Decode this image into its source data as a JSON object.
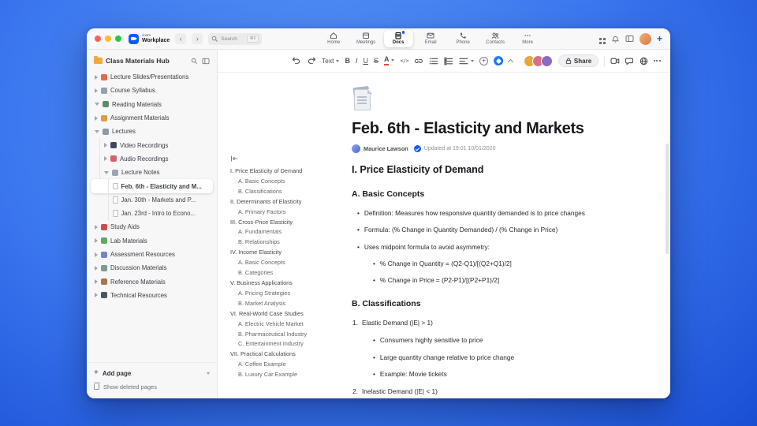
{
  "accent_color": "#0b5cff",
  "titlebar": {
    "traffic_lights": [
      "#ff5f57",
      "#febc2e",
      "#28c840"
    ],
    "logo_zoom": "zoom",
    "logo_workplace": "Workplace",
    "nav_back": "‹",
    "nav_forward": "›",
    "search_placeholder": "Search",
    "search_shortcut": "⌘F",
    "tabs": [
      {
        "label": "Home"
      },
      {
        "label": "Meetings"
      },
      {
        "label": "Docs",
        "active": true
      },
      {
        "label": "Email"
      },
      {
        "label": "Phone"
      },
      {
        "label": "Contacts"
      },
      {
        "label": "More"
      }
    ],
    "plus_label": "+"
  },
  "sidebar": {
    "title": "Class Materials Hub",
    "items": [
      {
        "label": "Lecture Slides/Presentations",
        "level": 0,
        "chevron": "right",
        "color": "#e06b4e"
      },
      {
        "label": "Course Syllabus",
        "level": 0,
        "chevron": "right",
        "color": "#93a1b1"
      },
      {
        "label": "Reading Materials",
        "level": 0,
        "chevron": "down",
        "color": "#5f8a6e"
      },
      {
        "label": "Assignment Materials",
        "level": 0,
        "chevron": "right",
        "color": "#e09a3e"
      },
      {
        "label": "Lectures",
        "level": 0,
        "chevron": "down",
        "color": "#8e98a8"
      },
      {
        "label": "Video Recordings",
        "level": 1,
        "chevron": "right",
        "color": "#3f4a5a"
      },
      {
        "label": "Audio Recordings",
        "level": 1,
        "chevron": "right",
        "color": "#d4606e"
      },
      {
        "label": "Lecture Notes",
        "level": 1,
        "chevron": "down",
        "color": "#9aa6b4"
      },
      {
        "label": "Feb. 6th - Elasticity and M...",
        "level": 2,
        "file": true,
        "selected": true
      },
      {
        "label": "Jan. 30th - Markets and P...",
        "level": 2,
        "file": true
      },
      {
        "label": "Jan. 23rd - Intro to Econo...",
        "level": 2,
        "file": true
      },
      {
        "label": "Study Aids",
        "level": 0,
        "chevron": "right",
        "color": "#c9504e"
      },
      {
        "label": "Lab Materials",
        "level": 0,
        "chevron": "right",
        "color": "#62a85e"
      },
      {
        "label": "Assessment Resources",
        "level": 0,
        "chevron": "right",
        "color": "#7287c2"
      },
      {
        "label": "Discussion Materials",
        "level": 0,
        "chevron": "right",
        "color": "#7f9b8e"
      },
      {
        "label": "Reference Materials",
        "level": 0,
        "chevron": "right",
        "color": "#a8764a"
      },
      {
        "label": "Technical Resources",
        "level": 0,
        "chevron": "right",
        "color": "#4a5568"
      }
    ],
    "add_page": "Add page",
    "add_page_plus": "+",
    "show_deleted": "Show deleted pages"
  },
  "toolbar": {
    "text_style": "Text",
    "bold": "B",
    "italic": "I",
    "underline": "U",
    "strikethrough": "S",
    "font_color": "A",
    "code": "</>",
    "plus": "+",
    "share": "Share",
    "avatars": [
      {
        "color": "#e5a83c"
      },
      {
        "color": "#d97087"
      },
      {
        "color": "#8a6bbf"
      }
    ]
  },
  "doc": {
    "title": "Feb. 6th - Elasticity and Markets",
    "author": "Maurice Lawson",
    "updated": "Updated at 19:01 10/01/2020"
  },
  "outline": {
    "items": [
      {
        "label": "I. Price Elasticity of Demand",
        "level": 0
      },
      {
        "label": "A. Basic Concepts",
        "level": 1
      },
      {
        "label": "B. Classifications",
        "level": 1
      },
      {
        "label": "II. Determinants of Elasticity",
        "level": 0
      },
      {
        "label": "A. Primary Factors",
        "level": 1
      },
      {
        "label": "III. Cross-Price Elasticity",
        "level": 0
      },
      {
        "label": "A. Fundamentals",
        "level": 1
      },
      {
        "label": "B. Relationships",
        "level": 1
      },
      {
        "label": "IV. Income Elasticity",
        "level": 0
      },
      {
        "label": "A. Basic Concepts",
        "level": 1
      },
      {
        "label": "B. Categories",
        "level": 1
      },
      {
        "label": "V. Business Applications",
        "level": 0
      },
      {
        "label": "A. Pricing Strategies",
        "level": 1
      },
      {
        "label": "B. Market Analysis",
        "level": 1
      },
      {
        "label": "VI. Real-World Case Studies",
        "level": 0
      },
      {
        "label": "A. Electric Vehicle Market",
        "level": 1
      },
      {
        "label": "B. Pharmaceutical Industry",
        "level": 1
      },
      {
        "label": "C. Entertainment Industry",
        "level": 1
      },
      {
        "label": "VII. Practical Calculations",
        "level": 0
      },
      {
        "label": "A. Coffee Example",
        "level": 1
      },
      {
        "label": "B. Luxury Car Example",
        "level": 1
      }
    ]
  },
  "content": {
    "h1": "I. Price Elasticity of Demand",
    "blocks": [
      {
        "t": "h2",
        "text": "A. Basic Concepts"
      },
      {
        "t": "li1",
        "text": "Definition: Measures how responsive quantity demanded is to price changes"
      },
      {
        "t": "li1",
        "text": "Formula: (% Change in Quantity Demanded) / (% Change in Price)"
      },
      {
        "t": "li1",
        "text": "Uses midpoint formula to avoid asymmetry:"
      },
      {
        "t": "li2",
        "text": "% Change in Quantity = (Q2-Q1)/[(Q2+Q1)/2]"
      },
      {
        "t": "li2",
        "text": "% Change in Price = (P2-P1)/[(P2+P1)/2]"
      },
      {
        "t": "h2",
        "text": "B. Classifications"
      },
      {
        "t": "num",
        "n": "1.",
        "text": "Elastic Demand (|E| > 1)"
      },
      {
        "t": "li2",
        "text": "Consumers highly sensitive to price"
      },
      {
        "t": "li2",
        "text": "Large quantity change relative to price change"
      },
      {
        "t": "li2",
        "text": "Example: Movie tickets"
      },
      {
        "t": "num",
        "n": "2.",
        "text": "Inelastic Demand (|E| < 1)"
      }
    ]
  }
}
